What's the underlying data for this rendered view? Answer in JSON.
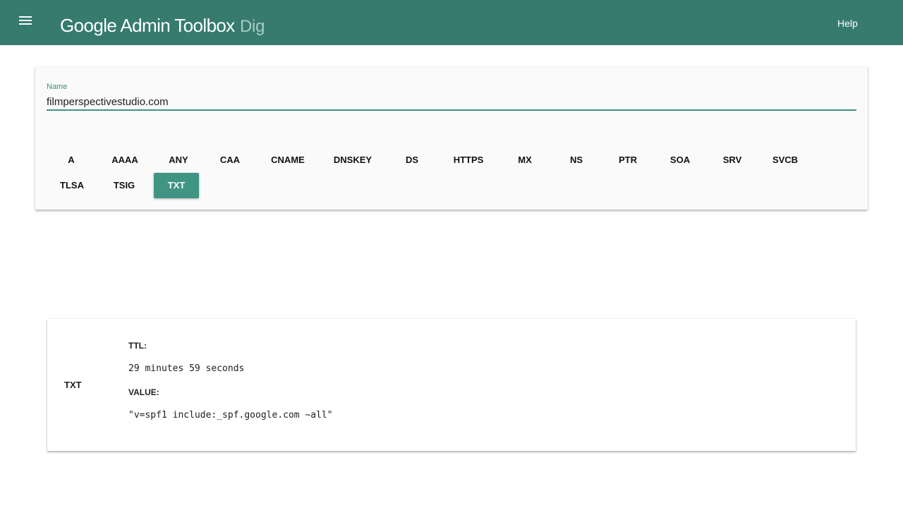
{
  "header": {
    "title": "Google Admin Toolbox",
    "subtitle": "Dig",
    "help_label": "Help",
    "menu_icon": "hamburger-menu-icon",
    "bg_color": "#367b6e"
  },
  "query": {
    "name_label": "Name",
    "name_value": "filmperspectivestudio.com",
    "accent_color": "#3f9483",
    "record_types": [
      "A",
      "AAAA",
      "ANY",
      "CAA",
      "CNAME",
      "DNSKEY",
      "DS",
      "HTTPS",
      "MX",
      "NS",
      "PTR",
      "SOA",
      "SRV",
      "SVCB",
      "TLSA",
      "TSIG",
      "TXT"
    ],
    "selected_type": "TXT"
  },
  "result": {
    "record_type": "TXT",
    "ttl_label": "TTL:",
    "ttl_value": "29 minutes 59 seconds",
    "value_label": "VALUE:",
    "value": "\"v=spf1 include:_spf.google.com ~all\""
  }
}
